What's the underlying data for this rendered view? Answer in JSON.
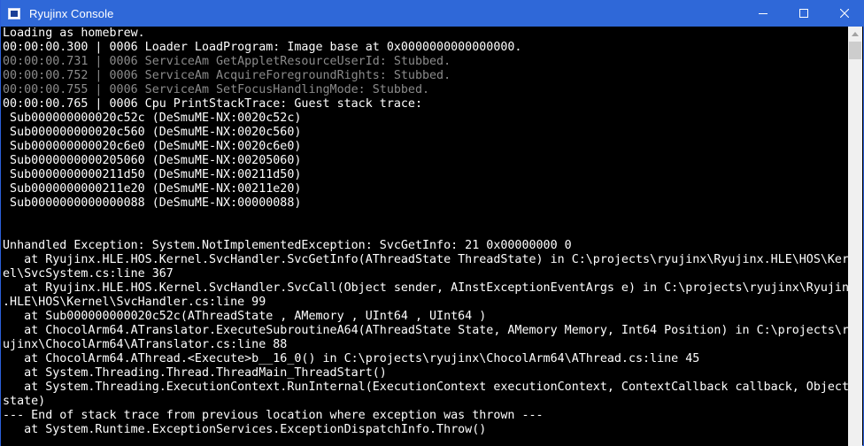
{
  "window": {
    "title": "Ryujinx Console",
    "controls": {
      "minimize_icon": "minimize-icon",
      "maximize_icon": "maximize-icon",
      "close_icon": "close-icon"
    }
  },
  "console": {
    "lines": [
      {
        "text": "Loading as homebrew.",
        "style": "white"
      },
      {
        "text": "00:00:00.300 | 0006 Loader LoadProgram: Image base at 0x0000000000000000.",
        "style": "white"
      },
      {
        "text": "00:00:00.731 | 0006 ServiceAm GetAppletResourceUserId: Stubbed.",
        "style": "gray"
      },
      {
        "text": "00:00:00.752 | 0006 ServiceAm AcquireForegroundRights: Stubbed.",
        "style": "gray"
      },
      {
        "text": "00:00:00.755 | 0006 ServiceAm SetFocusHandlingMode: Stubbed.",
        "style": "gray"
      },
      {
        "text": "00:00:00.765 | 0006 Cpu PrintStackTrace: Guest stack trace:",
        "style": "white"
      },
      {
        "text": " Sub000000000020c52c (DeSmuME-NX:0020c52c)",
        "style": "white"
      },
      {
        "text": " Sub000000000020c560 (DeSmuME-NX:0020c560)",
        "style": "white"
      },
      {
        "text": " Sub000000000020c6e0 (DeSmuME-NX:0020c6e0)",
        "style": "white"
      },
      {
        "text": " Sub0000000000205060 (DeSmuME-NX:00205060)",
        "style": "white"
      },
      {
        "text": " Sub0000000000211d50 (DeSmuME-NX:00211d50)",
        "style": "white"
      },
      {
        "text": " Sub0000000000211e20 (DeSmuME-NX:00211e20)",
        "style": "white"
      },
      {
        "text": " Sub0000000000000088 (DeSmuME-NX:00000088)",
        "style": "white"
      },
      {
        "text": "",
        "style": "white"
      },
      {
        "text": "",
        "style": "white"
      },
      {
        "text": "Unhandled Exception: System.NotImplementedException: SvcGetInfo: 21 0x00000000 0",
        "style": "white"
      },
      {
        "text": "   at Ryujinx.HLE.HOS.Kernel.SvcHandler.SvcGetInfo(AThreadState ThreadState) in C:\\projects\\ryujinx\\Ryujinx.HLE\\HOS\\Kern",
        "style": "white"
      },
      {
        "text": "el\\SvcSystem.cs:line 367",
        "style": "white"
      },
      {
        "text": "   at Ryujinx.HLE.HOS.Kernel.SvcHandler.SvcCall(Object sender, AInstExceptionEventArgs e) in C:\\projects\\ryujinx\\Ryujinx",
        "style": "white"
      },
      {
        "text": ".HLE\\HOS\\Kernel\\SvcHandler.cs:line 99",
        "style": "white"
      },
      {
        "text": "   at Sub000000000020c52c(AThreadState , AMemory , UInt64 , UInt64 )",
        "style": "white"
      },
      {
        "text": "   at ChocolArm64.ATranslator.ExecuteSubroutineA64(AThreadState State, AMemory Memory, Int64 Position) in C:\\projects\\ry",
        "style": "white"
      },
      {
        "text": "ujinx\\ChocolArm64\\ATranslator.cs:line 88",
        "style": "white"
      },
      {
        "text": "   at ChocolArm64.AThread.<Execute>b__16_0() in C:\\projects\\ryujinx\\ChocolArm64\\AThread.cs:line 45",
        "style": "white"
      },
      {
        "text": "   at System.Threading.Thread.ThreadMain_ThreadStart()",
        "style": "white"
      },
      {
        "text": "   at System.Threading.ExecutionContext.RunInternal(ExecutionContext executionContext, ContextCallback callback, Object",
        "style": "white"
      },
      {
        "text": "state)",
        "style": "white"
      },
      {
        "text": "--- End of stack trace from previous location where exception was thrown ---",
        "style": "white"
      },
      {
        "text": "   at System.Runtime.ExceptionServices.ExceptionDispatchInfo.Throw()",
        "style": "white"
      }
    ]
  },
  "colors": {
    "titlebar": "#2f68d8",
    "console_bg": "#000000",
    "text_white": "#ffffff",
    "text_gray": "#8b8b8b"
  }
}
